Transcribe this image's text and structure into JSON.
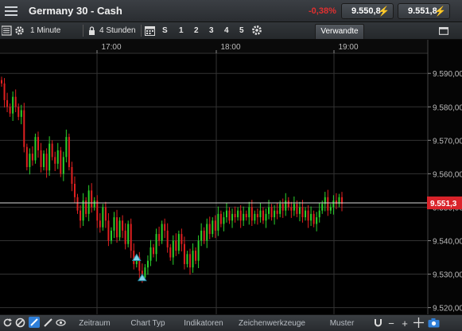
{
  "header": {
    "instrument": "Germany 30 - Cash",
    "change": "-0,38%",
    "sell_price": "9.550,8",
    "buy_price": "9.551,8",
    "colors": {
      "change": "#e03030",
      "sell_arrow": "#f0a030",
      "buy_arrow": "#4aa8e8"
    }
  },
  "toolbar": {
    "interval": "1 Minute",
    "range": "4 Stunden",
    "zoom_buttons": [
      "S",
      "1",
      "2",
      "3",
      "4",
      "5"
    ],
    "related_tab": "Verwandte"
  },
  "chart_data": {
    "type": "candlestick",
    "x_tick_labels": [
      "17:00",
      "18:00",
      "19:00"
    ],
    "y_tick_labels": [
      "9.590,00",
      "9.580,00",
      "9.570,00",
      "9.560,00",
      "9.550,00",
      "9.540,00",
      "9.530,00",
      "9.520,00"
    ],
    "ylim": [
      9518,
      9596
    ],
    "current_price_label": "9.551,3",
    "current_price": 9551.3,
    "colors": {
      "up": "#2bd12b",
      "down": "#e02020",
      "price_tag": "#d9232a",
      "grid": "#333333"
    },
    "markers": [
      {
        "type": "trade-marker",
        "time_index": 48,
        "price": 9535
      },
      {
        "type": "trade-marker",
        "time_index": 50,
        "price": 9529
      }
    ],
    "grid": true,
    "closes": [
      9587,
      9582,
      9580,
      9578,
      9583,
      9580,
      9577,
      9579,
      9568,
      9562,
      9566,
      9564,
      9571,
      9567,
      9562,
      9566,
      9561,
      9569,
      9565,
      9563,
      9567,
      9560,
      9565,
      9571,
      9562,
      9557,
      9553,
      9549,
      9546,
      9552,
      9548,
      9555,
      9550,
      9552,
      9546,
      9544,
      9550,
      9546,
      9540,
      9543,
      9547,
      9541,
      9546,
      9543,
      9539,
      9545,
      9537,
      9533,
      9535,
      9531,
      9529,
      9532,
      9534,
      9538,
      9536,
      9542,
      9540,
      9545,
      9543,
      9538,
      9535,
      9540,
      9537,
      9542,
      9539,
      9533,
      9536,
      9532,
      9537,
      9534,
      9540,
      9543,
      9540,
      9545,
      9542,
      9546,
      9543,
      9548,
      9545,
      9547,
      9549,
      9546,
      9548,
      9547,
      9549,
      9546,
      9548,
      9547,
      9550,
      9546,
      9548,
      9547,
      9549,
      9546,
      9548,
      9550,
      9547,
      9549,
      9548,
      9551,
      9549,
      9552,
      9550,
      9549,
      9551,
      9548,
      9550,
      9547,
      9549,
      9546,
      9548,
      9545,
      9547,
      9549,
      9551,
      9553,
      9549,
      9550,
      9552,
      9551,
      9553,
      9551
    ]
  },
  "bottom_bar": {
    "tabs": [
      "Zeitraum",
      "Chart Typ",
      "Indikatoren",
      "Zeichenwerkzeuge",
      "Muster"
    ]
  }
}
